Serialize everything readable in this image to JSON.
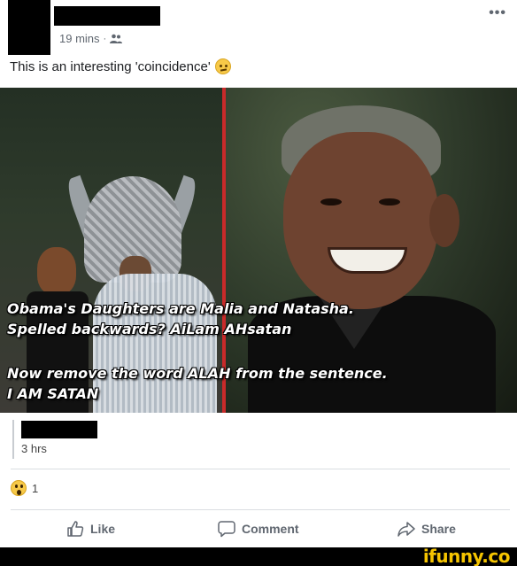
{
  "post": {
    "time": "19 mins",
    "separator": "·",
    "audience_icon": "friends-icon",
    "more_icon": "more-options-icon",
    "more_label": "•••",
    "text": "This is an interesting 'coincidence'",
    "text_emoji": "thinking-face-icon"
  },
  "meme": {
    "lines": [
      "Obama's Daughters are Malia and Natasha.",
      "Spelled backwards? AiLam AHsatan",
      "Now remove the word ALAH from the sentence.",
      "I AM SATAN"
    ],
    "divider_color": "#c92a2a"
  },
  "comment": {
    "time": "3 hrs"
  },
  "reactions": {
    "icon": "wow-reaction-icon",
    "count": "1"
  },
  "actions": {
    "like": "Like",
    "comment": "Comment",
    "share": "Share"
  },
  "watermark": {
    "text": "ifunny.co"
  }
}
